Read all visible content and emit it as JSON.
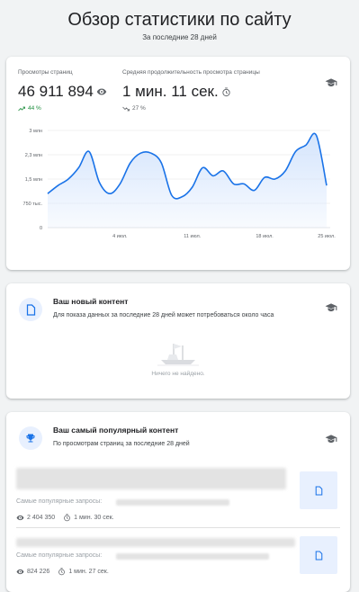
{
  "page": {
    "title": "Обзор статистики по сайту",
    "subtitle": "За последние 28 дней"
  },
  "stats": {
    "views": {
      "label": "Просмотры страниц",
      "value": "46 911 894",
      "change": "44 %",
      "trend": "up"
    },
    "duration": {
      "label": "Средняя продолжительность просмотра страницы",
      "value": "1 мин. 11 сек.",
      "change": "27 %",
      "trend": "down"
    }
  },
  "chart_data": {
    "type": "area",
    "x_tick_labels": [
      "4 июл.",
      "11 июл.",
      "18 июл.",
      "25 июл."
    ],
    "y_tick_labels": [
      "0",
      "750 тыс.",
      "1,5 млн",
      "2,3 млн",
      "3 млн"
    ],
    "ylim": [
      0,
      3000000
    ],
    "x": [
      0,
      1,
      2,
      3,
      4,
      5,
      6,
      7,
      8,
      9,
      10,
      11,
      12,
      13,
      14,
      15,
      16,
      17,
      18,
      19,
      20,
      21,
      22,
      23,
      24,
      25,
      26,
      27
    ],
    "values": [
      1050000,
      1300000,
      1500000,
      1850000,
      2350000,
      1400000,
      1050000,
      1350000,
      2000000,
      2300000,
      2300000,
      2000000,
      1000000,
      950000,
      1250000,
      1850000,
      1600000,
      1750000,
      1350000,
      1350000,
      1150000,
      1550000,
      1500000,
      1750000,
      2350000,
      2550000,
      2850000,
      1300000
    ],
    "color": "#1a73e8",
    "fill_color": "#d2e3fc"
  },
  "new_content": {
    "title": "Ваш новый контент",
    "description": "Для показа данных за последние 28 дней может потребоваться около часа",
    "empty": "Ничего не найдено."
  },
  "popular": {
    "title": "Ваш самый популярный контент",
    "description": "По просмотрам страниц за последние 28 дней",
    "items": [
      {
        "queries_label": "Самые популярные запросы:",
        "views": "2 404 350",
        "duration": "1 мин. 30 сек."
      },
      {
        "queries_label": "Самые популярные запросы:",
        "views": "824 226",
        "duration": "1 мин. 27 сек."
      }
    ]
  },
  "colors": {
    "accent": "#1a73e8",
    "positive": "#1e8e3e",
    "icon_bg": "#e8f0fe"
  }
}
